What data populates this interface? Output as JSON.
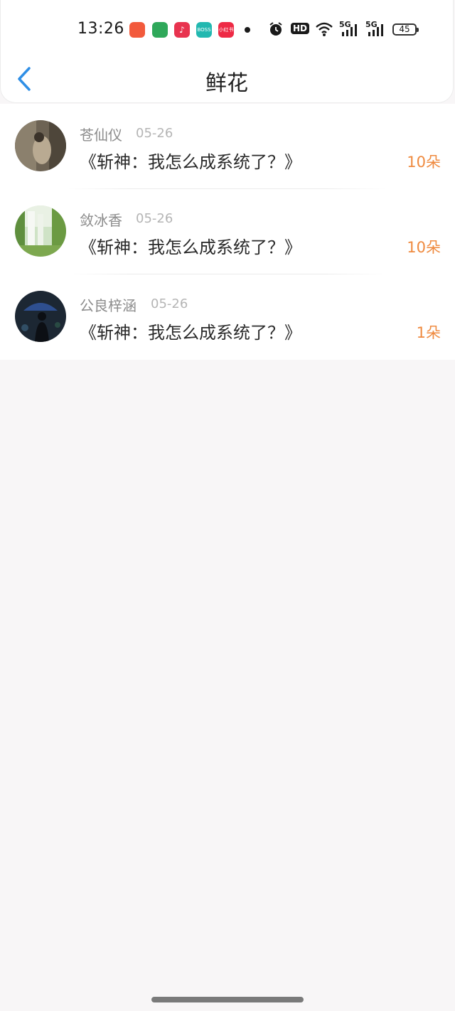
{
  "status_bar": {
    "time": "13:26",
    "signal1": "5G",
    "signal2": "5G",
    "hd": "HD",
    "battery": "45",
    "apps": [
      {
        "name": "app-icon-1",
        "color": "#f25a3c",
        "label": ""
      },
      {
        "name": "app-icon-2",
        "color": "#2fa85a",
        "label": ""
      },
      {
        "name": "app-icon-3",
        "color": "#e8334f",
        "label": "♪"
      },
      {
        "name": "app-icon-4",
        "color": "#22b8b0",
        "label": "BOSS"
      },
      {
        "name": "app-icon-5",
        "color": "#ee2a45",
        "label": "小红书"
      }
    ]
  },
  "header": {
    "title": "鲜花",
    "back_color": "#2f8fe6"
  },
  "items": [
    {
      "name": "苍仙仪",
      "date": "05-26",
      "book": "《斩神：我怎么成系统了？》",
      "amount": "10朵"
    },
    {
      "name": "敛冰香",
      "date": "05-26",
      "book": "《斩神：我怎么成系统了？》",
      "amount": "10朵"
    },
    {
      "name": "公良梓涵",
      "date": "05-26",
      "book": "《斩神：我怎么成系统了？》",
      "amount": "1朵"
    }
  ],
  "colors": {
    "accent_orange": "#ef8a3f",
    "background": "#f8f6f7"
  }
}
